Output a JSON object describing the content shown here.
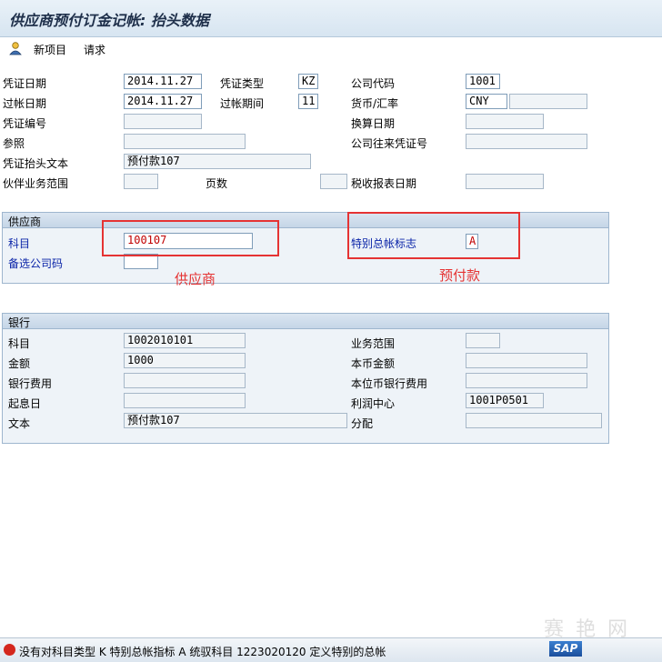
{
  "window": {
    "title": "供应商预付订金记帐: 抬头数据"
  },
  "toolbar": {
    "new_item": "新项目",
    "request": "请求"
  },
  "header": {
    "doc_date": {
      "label": "凭证日期",
      "value": "2014.11.27"
    },
    "doc_type": {
      "label": "凭证类型",
      "value": "KZ"
    },
    "company_code": {
      "label": "公司代码",
      "value": "1001"
    },
    "posting_date": {
      "label": "过帐日期",
      "value": "2014.11.27"
    },
    "period": {
      "label": "过帐期间",
      "value": "11"
    },
    "currency": {
      "label": "货币/汇率",
      "value": "CNY",
      "rate": ""
    },
    "doc_number": {
      "label": "凭证编号",
      "value": ""
    },
    "translation_date": {
      "label": "换算日期",
      "value": ""
    },
    "reference": {
      "label": "参照",
      "value": ""
    },
    "cross_cc_number": {
      "label": "公司往来凭证号",
      "value": ""
    },
    "header_text": {
      "label": "凭证抬头文本",
      "value": "预付款107"
    },
    "trading_partner": {
      "label": "伙伴业务范围",
      "value": ""
    },
    "pages": {
      "label": "页数",
      "value": ""
    },
    "tax_report_date": {
      "label": "税收报表日期",
      "value": ""
    }
  },
  "vendor": {
    "group_title": "供应商",
    "account": {
      "label": "科目",
      "value": "100107"
    },
    "special_gl": {
      "label": "特别总帐标志",
      "value": "A"
    },
    "alt_company_code": {
      "label": "备选公司码",
      "value": ""
    },
    "annotation_vendor": "供应商",
    "annotation_prepay": "预付款"
  },
  "bank": {
    "group_title": "银行",
    "account": {
      "label": "科目",
      "value": "1002010101"
    },
    "business_area": {
      "label": "业务范围",
      "value": ""
    },
    "amount": {
      "label": "金额",
      "value": "1000"
    },
    "amount_local": {
      "label": "本币金额",
      "value": ""
    },
    "bank_charges": {
      "label": "银行费用",
      "value": ""
    },
    "bank_charges_local": {
      "label": "本位币银行费用",
      "value": ""
    },
    "value_date": {
      "label": "起息日",
      "value": ""
    },
    "profit_center": {
      "label": "利润中心",
      "value": "1001P0501"
    },
    "text": {
      "label": "文本",
      "value": "预付款107"
    },
    "assignment": {
      "label": "分配",
      "value": ""
    }
  },
  "status": {
    "message": "没有对科目类型 K 特别总帐指标 A 统驭科目 1223020120 定义特别的总帐",
    "icon": "error-icon"
  },
  "watermark": "赛 艳 网",
  "branding": {
    "logo": "SAP"
  }
}
